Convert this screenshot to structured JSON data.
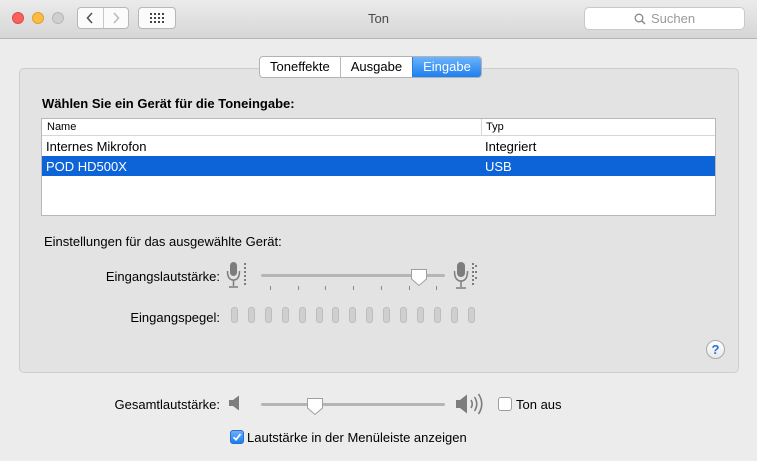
{
  "window": {
    "title": "Ton"
  },
  "search": {
    "placeholder": "Suchen"
  },
  "tabs": [
    {
      "label": "Toneffekte",
      "selected": false
    },
    {
      "label": "Ausgabe",
      "selected": false
    },
    {
      "label": "Eingabe",
      "selected": true
    }
  ],
  "input": {
    "heading": "Wählen Sie ein Gerät für die Toneingabe:",
    "columns": {
      "name": "Name",
      "type": "Typ"
    },
    "devices": [
      {
        "name": "Internes Mikrofon",
        "type": "Integriert",
        "selected": false
      },
      {
        "name": "POD HD500X",
        "type": "USB",
        "selected": true
      }
    ],
    "settings_heading": "Einstellungen für das ausgewählte Gerät:",
    "volume_label": "Eingangslautstärke:",
    "volume_level": 0.9,
    "level_label": "Eingangspegel:",
    "level_segments": 15,
    "level_active": 0
  },
  "output": {
    "volume_label": "Gesamtlautstärke:",
    "volume_level": 0.27,
    "mute_label": "Ton aus",
    "mute_checked": false,
    "menubar_label": "Lautstärke in der Menüleiste anzeigen",
    "menubar_checked": true
  },
  "colors": {
    "accent": "#0d64d8",
    "close": "#fc605c",
    "minimize": "#fdbc40"
  },
  "icons": {
    "back": "chevron-left-icon",
    "forward": "chevron-right-icon",
    "grid": "grid-icon",
    "search": "search-icon",
    "mic": "microphone-icon",
    "speaker": "speaker-icon",
    "help": "help-icon"
  }
}
